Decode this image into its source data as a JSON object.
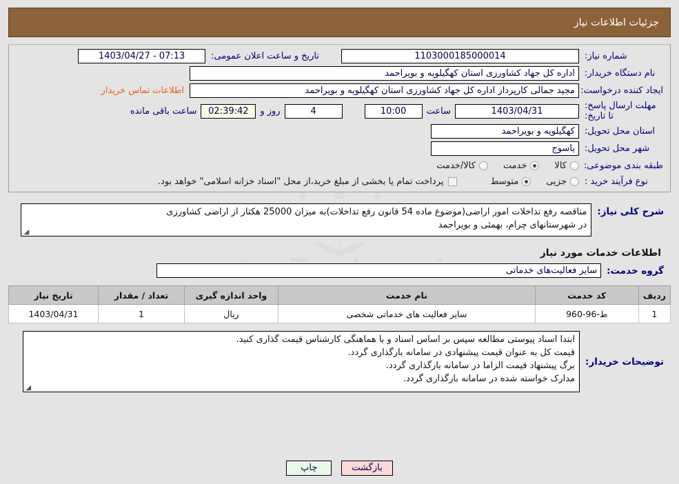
{
  "header": {
    "title": "جزئیات اطلاعات نیاز"
  },
  "watermark": {
    "text_left": "Ana",
    "text_right": "Tender.net"
  },
  "summary": {
    "need_number_label": "شماره نیاز:",
    "need_number_value": "1103000185000014",
    "public_announce_label": "تاریخ و ساعت اعلان عمومی:",
    "public_announce_value": "1403/04/27 - 07:13",
    "buyer_org_label": "نام دستگاه خریدار:",
    "buyer_org_value": "اداره کل جهاد کشاورزی استان کهگیلویه و بویراحمد",
    "creator_label": "ایجاد کننده درخواست:",
    "creator_value": "مجید جمالی کارپرداز اداره کل جهاد کشاورزی استان کهگیلویه و بویراحمد",
    "contact_link": "اطلاعات تماس خریدار",
    "deadline_label": "مهلت ارسال پاسخ: تا تاریخ:",
    "deadline_date": "1403/04/31",
    "hour_label": "ساعت",
    "deadline_hour": "10:00",
    "days_value": "4",
    "days_label": "روز و",
    "countdown_value": "02:39:42",
    "remaining_label": "ساعت باقی مانده",
    "province_label": "استان محل تحویل:",
    "province_value": "کهگیلویه و بویراحمد",
    "city_label": "شهر محل تحویل:",
    "city_value": "یاسوج",
    "category_label": "طبقه بندی موضوعی:",
    "category_options": [
      {
        "label": "کالا",
        "selected": false
      },
      {
        "label": "خدمت",
        "selected": true
      },
      {
        "label": "کالا/خدمت",
        "selected": false
      }
    ],
    "process_label": "نوع فرآیند خرید :",
    "process_options": [
      {
        "label": "جزیی",
        "selected": false
      },
      {
        "label": "متوسط",
        "selected": true
      }
    ],
    "treasury_checkbox_label": "پرداخت تمام یا بخشی از مبلغ خرید،از محل \"اسناد خزانه اسلامی\" خواهد بود.",
    "treasury_checked": false
  },
  "description": {
    "label": "شرح کلی نیاز:",
    "lines": [
      "مناقصه رفع تداخلات امور اراضی(موضوع ماده 54 قانون رفع تداخلات)به میزان 25000 هکتار از اراضی کشاورزی",
      "در شهرستانهای چرام، بهمئی و بویراحمد"
    ]
  },
  "services_section": {
    "heading": "اطلاعات خدمات مورد نیاز",
    "group_label": "گروه خدمت:",
    "group_value": "سایر فعالیت‌های خدماتی"
  },
  "table": {
    "columns": [
      "ردیف",
      "کد خدمت",
      "نام خدمت",
      "واحد اندازه گیری",
      "تعداد / مقدار",
      "تاریخ نیاز"
    ],
    "rows": [
      {
        "index": "1",
        "code": "ط-96-960",
        "name": "سایر فعالیت های خدماتی شخصی",
        "unit": "ریال",
        "quantity": "1",
        "need_date": "1403/04/31"
      }
    ]
  },
  "buyer_notes": {
    "label": "توضیحات خریدار:",
    "lines": [
      "ابتدا اسناد پیوستی مطالعه سپس بر اساس اسناد و با هماهنگی کارشناس قیمت گذاری کنید.",
      "قیمت کل به عنوان قیمت پیشنهادی در سامانه بارگذاری گردد.",
      "برگ پیشنهاد قیمت الزاما در سامانه بارگذاری گردد.",
      "مدارک خواسته شده در سامانه بارگذاری گردد."
    ]
  },
  "footer": {
    "print_label": "چاپ",
    "back_label": "بازگشت"
  },
  "colors": {
    "header_bg": "#8c6239",
    "label_blue": "#00007a",
    "link_orange": "#e8601c",
    "print_bg": "#ebf7e8",
    "back_bg": "#fcd9d9",
    "table_header_bg": "#c9c9c9"
  }
}
